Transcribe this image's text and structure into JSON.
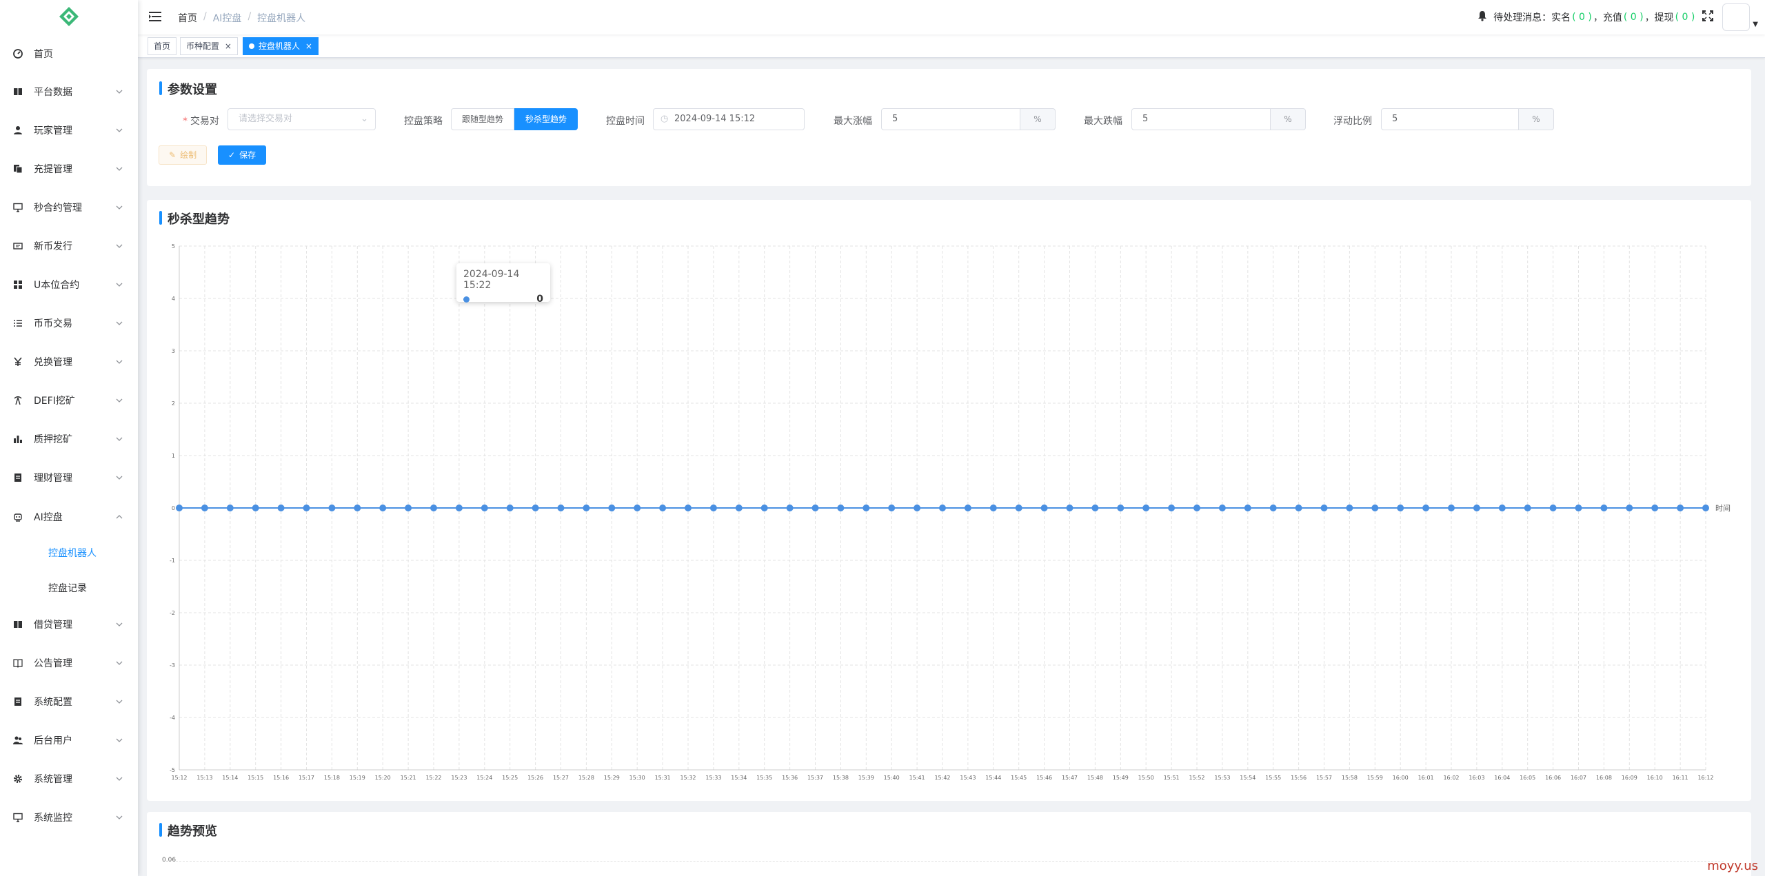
{
  "sidebar": {
    "items": [
      {
        "label": "首页",
        "icon": "dashboard-icon"
      },
      {
        "label": "平台数据",
        "icon": "book-icon"
      },
      {
        "label": "玩家管理",
        "icon": "user-icon"
      },
      {
        "label": "充提管理",
        "icon": "documents-icon"
      },
      {
        "label": "秒合约管理",
        "icon": "monitor-icon"
      },
      {
        "label": "新币发行",
        "icon": "ticket-icon"
      },
      {
        "label": "U本位合约",
        "icon": "grid-icon"
      },
      {
        "label": "币币交易",
        "icon": "list-icon"
      },
      {
        "label": "兑换管理",
        "icon": "yen-icon"
      },
      {
        "label": "DEFI挖矿",
        "icon": "mining-icon"
      },
      {
        "label": "质押挖矿",
        "icon": "bar-chart-icon"
      },
      {
        "label": "理财管理",
        "icon": "notebook-icon"
      },
      {
        "label": "AI控盘",
        "icon": "robot-icon"
      },
      {
        "label": "借贷管理",
        "icon": "book-icon"
      },
      {
        "label": "公告管理",
        "icon": "open-book-icon"
      },
      {
        "label": "系统配置",
        "icon": "notebook-icon"
      },
      {
        "label": "后台用户",
        "icon": "users-icon"
      },
      {
        "label": "系统管理",
        "icon": "gear-icon"
      },
      {
        "label": "系统监控",
        "icon": "monitor-icon"
      }
    ],
    "submenu": [
      "控盘机器人",
      "控盘记录"
    ]
  },
  "header": {
    "breadcrumb": [
      "首页",
      "AI控盘",
      "控盘机器人"
    ],
    "pending_label": "待处理消息：实名",
    "realname_count": "( 0 )",
    "recharge_label": "，充值",
    "recharge_count": "( 0 )",
    "withdraw_label": "，提现",
    "withdraw_count": "( 0 )"
  },
  "tags": [
    {
      "label": "首页",
      "active": false
    },
    {
      "label": "币种配置",
      "active": false
    },
    {
      "label": "控盘机器人",
      "active": true
    }
  ],
  "params": {
    "title": "参数设置",
    "pair_label": "交易对",
    "pair_placeholder": "请选择交易对",
    "strategy_label": "控盘策略",
    "strategy_options": [
      "跟随型趋势",
      "秒杀型趋势"
    ],
    "strategy_selected": "秒杀型趋势",
    "time_label": "控盘时间",
    "time_value": "2024-09-14 15:12",
    "max_rise_label": "最大涨幅",
    "max_rise_value": "5",
    "max_fall_label": "最大跌幅",
    "max_fall_value": "5",
    "float_label": "浮动比例",
    "float_value": "5",
    "percent": "%",
    "draw_button": "绘制",
    "save_button": "保存"
  },
  "trend": {
    "title": "秒杀型趋势",
    "tooltip_time": "2024-09-14 15:22",
    "tooltip_value": "0"
  },
  "preview": {
    "title": "趋势预览",
    "first_tick": "0.06"
  },
  "chart_data": {
    "type": "line",
    "title": "",
    "xlabel": "时间",
    "ylabel": "",
    "ylim": [
      -5,
      5
    ],
    "yticks": [
      5,
      4,
      3,
      2,
      1,
      0,
      -1,
      -2,
      -3,
      -4,
      -5
    ],
    "x": [
      "15:12",
      "15:13",
      "15:14",
      "15:15",
      "15:16",
      "15:17",
      "15:18",
      "15:19",
      "15:20",
      "15:21",
      "15:22",
      "15:23",
      "15:24",
      "15:25",
      "15:26",
      "15:27",
      "15:28",
      "15:29",
      "15:30",
      "15:31",
      "15:32",
      "15:33",
      "15:34",
      "15:35",
      "15:36",
      "15:37",
      "15:38",
      "15:39",
      "15:40",
      "15:41",
      "15:42",
      "15:43",
      "15:44",
      "15:45",
      "15:46",
      "15:47",
      "15:48",
      "15:49",
      "15:50",
      "15:51",
      "15:52",
      "15:53",
      "15:54",
      "15:55",
      "15:56",
      "15:57",
      "15:58",
      "15:59",
      "16:00",
      "16:01",
      "16:02",
      "16:03",
      "16:04",
      "16:05",
      "16:06",
      "16:07",
      "16:08",
      "16:09",
      "16:10",
      "16:11",
      "16:12"
    ],
    "series": [
      {
        "values": [
          0,
          0,
          0,
          0,
          0,
          0,
          0,
          0,
          0,
          0,
          0,
          0,
          0,
          0,
          0,
          0,
          0,
          0,
          0,
          0,
          0,
          0,
          0,
          0,
          0,
          0,
          0,
          0,
          0,
          0,
          0,
          0,
          0,
          0,
          0,
          0,
          0,
          0,
          0,
          0,
          0,
          0,
          0,
          0,
          0,
          0,
          0,
          0,
          0,
          0,
          0,
          0,
          0,
          0,
          0,
          0,
          0,
          0,
          0,
          0,
          0
        ],
        "color": "#4a90e2"
      }
    ],
    "grid": true
  },
  "watermark": "moyy.us",
  "colors": {
    "accent": "#1890ff",
    "line": "#4a90e2"
  }
}
